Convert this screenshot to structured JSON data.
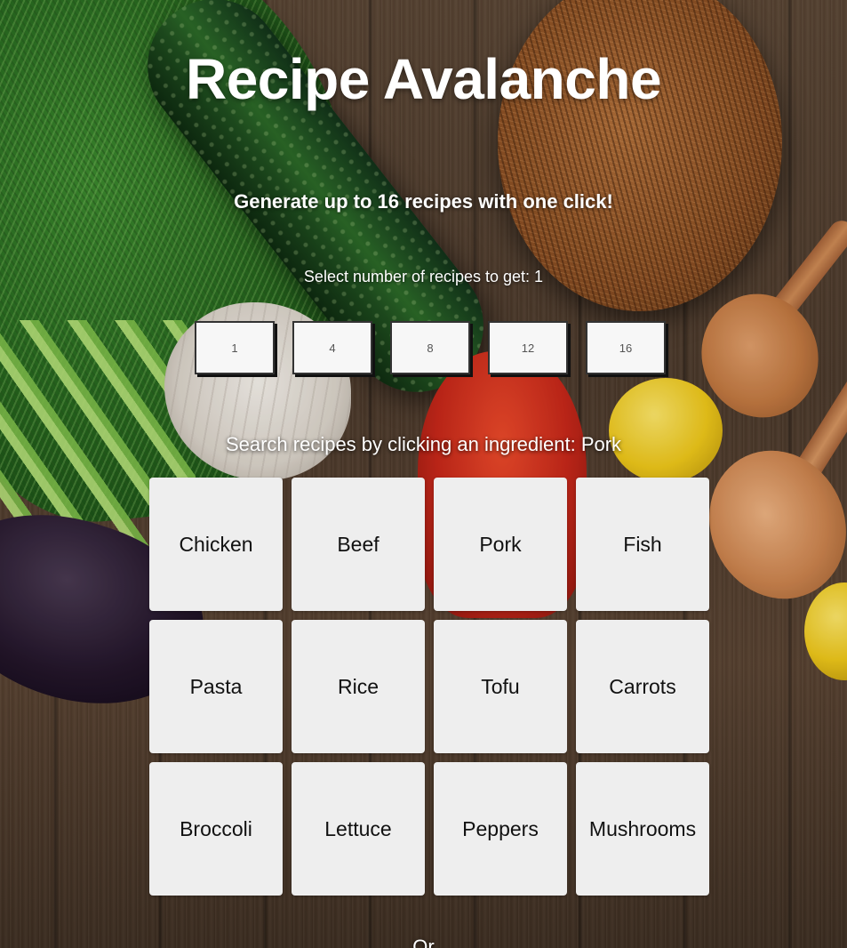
{
  "page": {
    "title": "Recipe Avalanche",
    "subtitle": "Generate up to 16 recipes with one click!"
  },
  "recipe_count": {
    "label": "Select number of recipes to get: 1",
    "options": [
      "1",
      "4",
      "8",
      "12",
      "16"
    ]
  },
  "ingredients": {
    "label": "Search recipes by clicking an ingredient: Pork",
    "items": [
      "Chicken",
      "Beef",
      "Pork",
      "Fish",
      "Pasta",
      "Rice",
      "Tofu",
      "Carrots",
      "Broccoli",
      "Lettuce",
      "Peppers",
      "Mushrooms"
    ]
  },
  "footer": {
    "or_text": "Or"
  },
  "colors": {
    "tile_background": "#eeeeee",
    "button_background": "#f7f7f7",
    "heading_text": "#ffffff"
  }
}
